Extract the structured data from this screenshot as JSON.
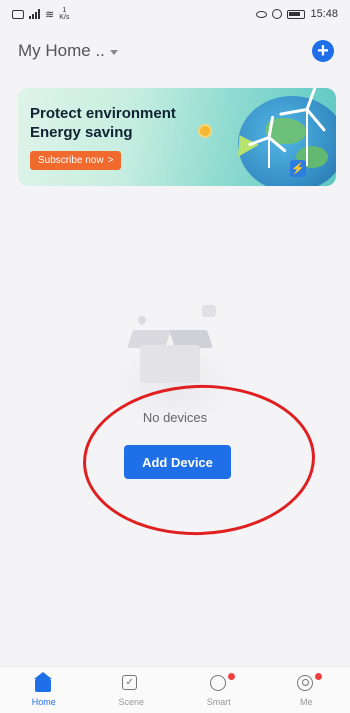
{
  "status_bar": {
    "netspeed_value": "1",
    "netspeed_unit": "K/s",
    "time": "15:48"
  },
  "header": {
    "home_name": "My Home ..",
    "add_icon": "plus-circle-icon"
  },
  "banner": {
    "title_line1": "Protect environment",
    "title_line2": "Energy saving",
    "subscribe_label": "Subscribe now",
    "subscribe_chevron": ">"
  },
  "empty_state": {
    "message": "No devices",
    "add_device_label": "Add Device"
  },
  "tabbar": {
    "tabs": [
      {
        "label": "Home",
        "icon": "home-icon",
        "active": true
      },
      {
        "label": "Scene",
        "icon": "scene-checkbox-icon",
        "active": false
      },
      {
        "label": "Smart",
        "icon": "smart-icon",
        "active": false
      },
      {
        "label": "Me",
        "icon": "profile-icon",
        "active": false
      }
    ]
  },
  "colors": {
    "accent": "#1f6fe8",
    "subscribe": "#f06a2e",
    "annotation": "#e02020",
    "badge": "#f04040"
  }
}
